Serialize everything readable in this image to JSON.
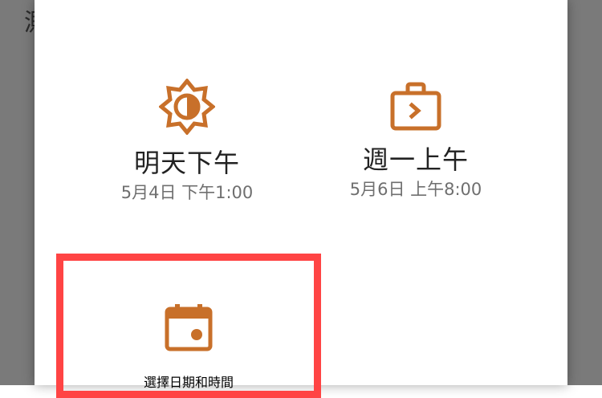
{
  "background": {
    "visible_text": "測"
  },
  "dialog": {
    "options": [
      {
        "icon": "brightness-sun-icon",
        "title": "明天下午",
        "subtitle": "5月4日 下午1:00"
      },
      {
        "icon": "briefcase-arrow-icon",
        "title": "週一上午",
        "subtitle": "5月6日 上午8:00"
      },
      {
        "icon": "calendar-event-icon",
        "title": "選擇日期和時間"
      }
    ]
  },
  "colors": {
    "accent": "#c8702a",
    "highlight": "#ff4444",
    "scrim": "#7a7a7a"
  }
}
